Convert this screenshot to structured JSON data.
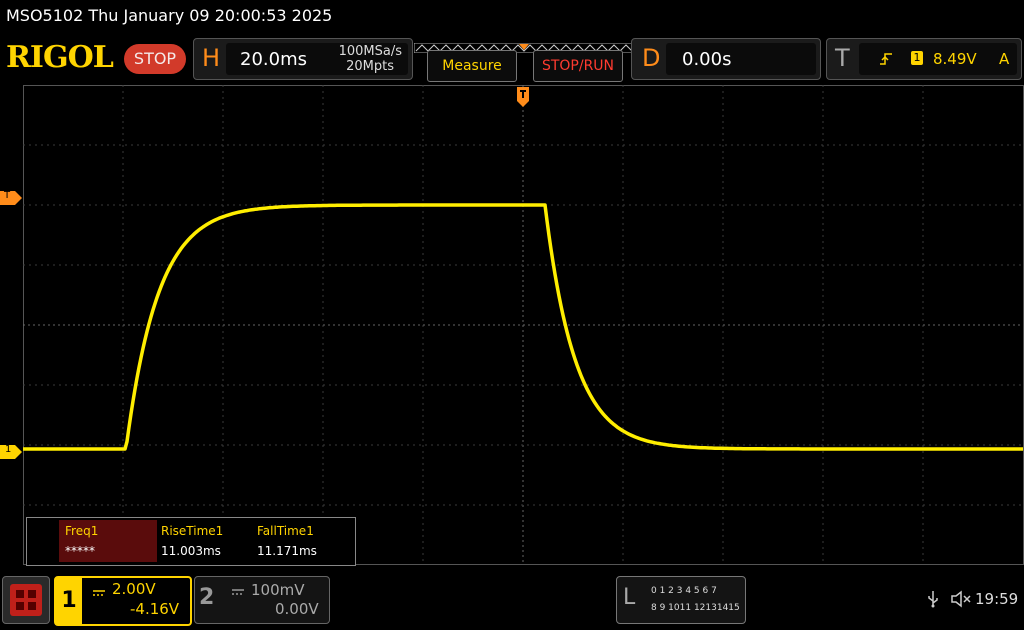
{
  "header": {
    "title": "MSO5102  Thu January 09 20:00:53 2025",
    "brand": "RIGOL",
    "run_status": "STOP"
  },
  "horizontal": {
    "letter": "H",
    "timebase": "20.0ms",
    "sample_rate": "100MSa/s",
    "memory_depth": "20Mpts"
  },
  "toolbar": {
    "measure_label": "Measure",
    "stop_run_label": "STOP/RUN"
  },
  "delay": {
    "letter": "D",
    "value": "0.00s"
  },
  "trigger": {
    "letter": "T",
    "channel_badge": "1",
    "level": "8.49V",
    "mode": "A",
    "marker_label": "T"
  },
  "channel1_marker": "1",
  "measurements": {
    "headers": [
      "Freq1",
      "RiseTime1",
      "FallTime1"
    ],
    "values": [
      "*****",
      "11.003ms",
      "11.171ms"
    ]
  },
  "channels": [
    {
      "number": "1",
      "scale": "2.00V",
      "offset": "-4.16V",
      "color": "#ffeb00"
    },
    {
      "number": "2",
      "scale": "100mV",
      "offset": "0.00V",
      "color": "#777777"
    }
  ],
  "digital": {
    "letter": "L",
    "row1": "0 1 2 3   4 5 6 7",
    "row2": "8 9 1011 12131415"
  },
  "system": {
    "time": "19:59"
  },
  "trace": {
    "color": "#ffee00",
    "grid_color": "#3a3a3a"
  }
}
